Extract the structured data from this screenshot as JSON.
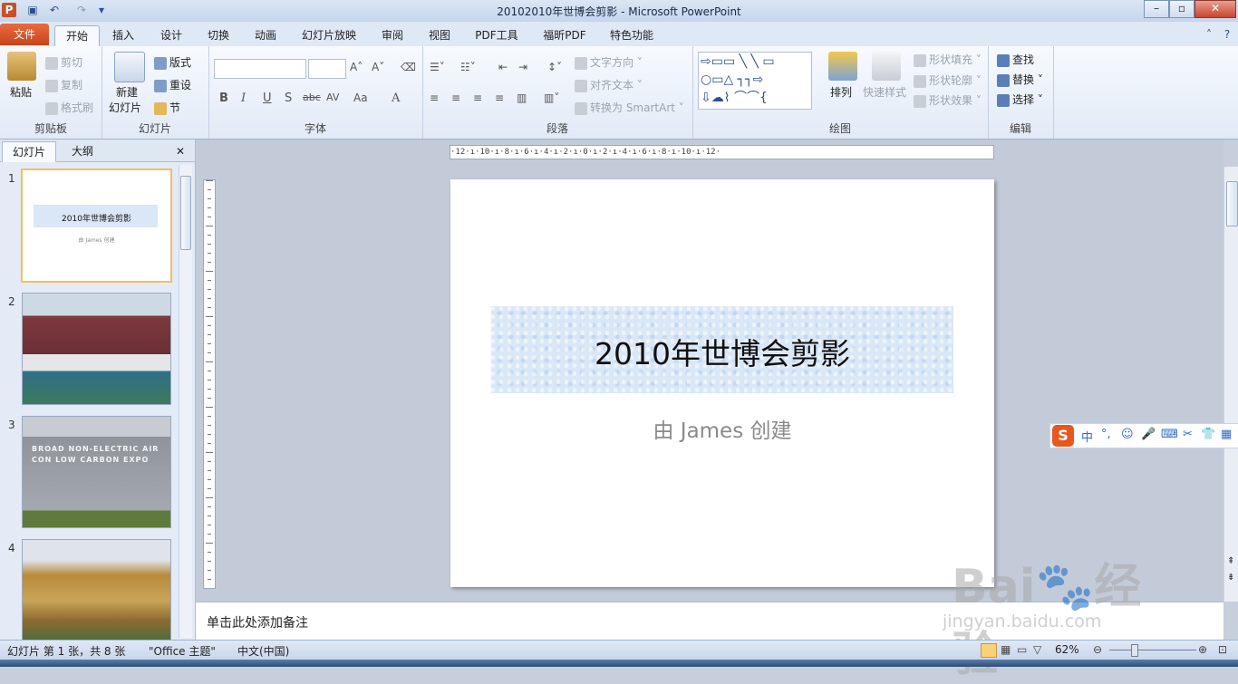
{
  "window": {
    "title": "20102010年世博会剪影  -  Microsoft PowerPoint",
    "app_icon": "P"
  },
  "tabs": [
    "文件",
    "开始",
    "插入",
    "设计",
    "切换",
    "动画",
    "幻灯片放映",
    "审阅",
    "视图",
    "PDF工具",
    "福昕PDF",
    "特色功能"
  ],
  "active_tab": "开始",
  "ribbon": {
    "clipboard": {
      "label": "剪贴板",
      "paste": "粘贴",
      "cut": "剪切",
      "copy": "复制",
      "format_painter": "格式刷"
    },
    "slides": {
      "label": "幻灯片",
      "new_slide_1": "新建",
      "new_slide_2": "幻灯片",
      "layout": "版式",
      "reset": "重设",
      "section": "节"
    },
    "font": {
      "label": "字体",
      "bold": "B",
      "italic": "I",
      "underline": "U",
      "shadow": "S",
      "strike": "abc",
      "spacing": "AV",
      "case": "Aa",
      "color": "A"
    },
    "paragraph": {
      "label": "段落",
      "text_direction": "文字方向",
      "align_text": "对齐文本",
      "smartart": "转换为 SmartArt"
    },
    "drawing": {
      "label": "绘图",
      "arrange": "排列",
      "quick_styles": "快速样式",
      "shape_fill": "形状填充",
      "shape_outline": "形状轮廓",
      "shape_effects": "形状效果"
    },
    "editing": {
      "label": "编辑",
      "find": "查找",
      "replace": "替换",
      "select": "选择"
    }
  },
  "pane": {
    "tab_slides": "幻灯片",
    "tab_outline": "大纲",
    "close": "✕",
    "slides": [
      {
        "num": "1",
        "title": "2010年世博会剪影",
        "subtitle": "由 James 创建"
      },
      {
        "num": "2"
      },
      {
        "num": "3",
        "caption": "BROAD NON-ELECTRIC AIR CON LOW CARBON EXPO"
      },
      {
        "num": "4"
      }
    ]
  },
  "ruler": {
    "h": "·12·ı·10·ı·8·ı·6·ı·4·ı·2·ı·0·ı·2·ı·4·ı·6·ı·8·ı·10·ı·12·"
  },
  "slide": {
    "title": "2010年世博会剪影",
    "subtitle": "由 James 创建"
  },
  "notes": {
    "placeholder": "单击此处添加备注"
  },
  "ime": {
    "logo": "S",
    "items": [
      "中",
      "°,",
      "☺",
      "🎤",
      "⌨",
      "✂",
      "👕",
      "▦"
    ]
  },
  "status": {
    "slide_info": "幻灯片 第 1 张，共 8 张",
    "theme": "\"Office 主题\"",
    "language": "中文(中国)",
    "zoom": "62%"
  },
  "watermark": {
    "brand": "Bai🐾经验",
    "url": "jingyan.baidu.com"
  },
  "colors": {
    "file_tab": "#c6451e",
    "title_box": "#d9e7f6",
    "selection": "#f0c060"
  }
}
